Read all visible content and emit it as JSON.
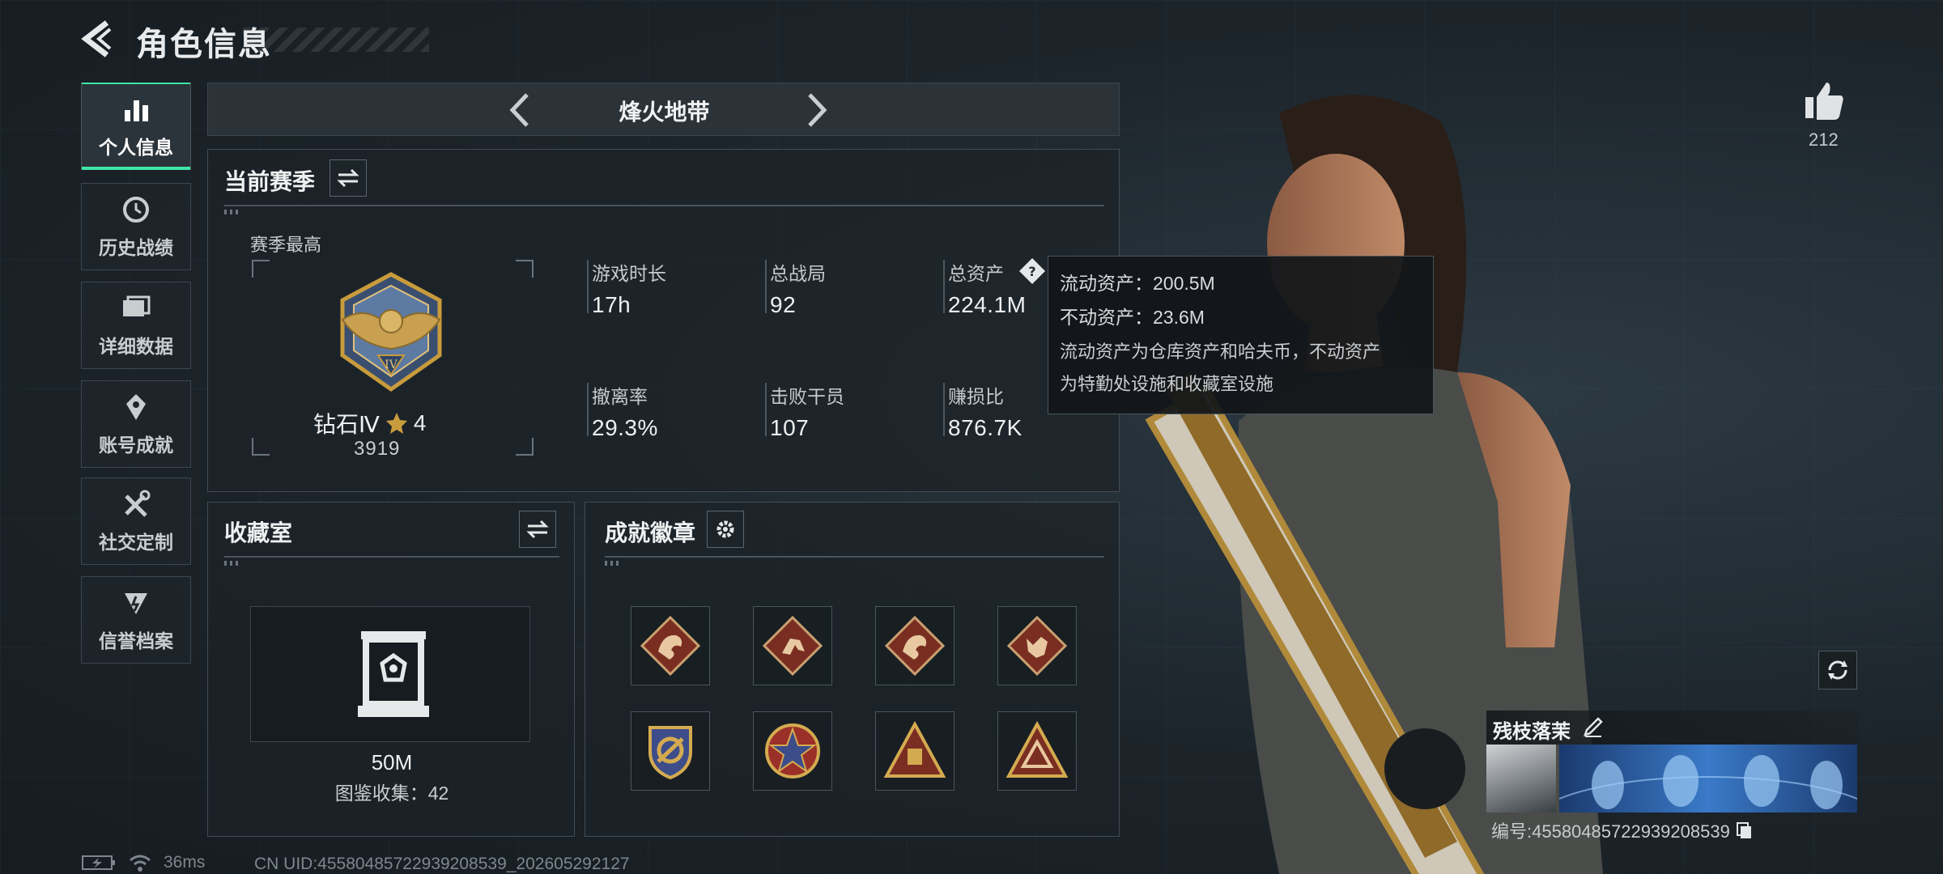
{
  "header": {
    "title": "角色信息"
  },
  "sidebar": {
    "items": [
      {
        "label": "个人信息",
        "icon": "bar-chart-icon",
        "active": true
      },
      {
        "label": "历史战绩",
        "icon": "history-icon"
      },
      {
        "label": "详细数据",
        "icon": "folder-icon"
      },
      {
        "label": "账号成就",
        "icon": "achievement-icon"
      },
      {
        "label": "社交定制",
        "icon": "tools-icon"
      },
      {
        "label": "信誉档案",
        "icon": "reputation-icon"
      }
    ]
  },
  "mode": {
    "title": "烽火地带"
  },
  "season": {
    "title": "当前赛季",
    "best_label": "赛季最高",
    "rank_name": "钻石Ⅳ",
    "rank_stars": "4",
    "rank_score": "3919",
    "stats": [
      {
        "label": "游戏时长",
        "value": "17h"
      },
      {
        "label": "总战局",
        "value": "92"
      },
      {
        "label": "总资产",
        "value": "224.1M"
      },
      {
        "label": "撤离率",
        "value": "29.3%"
      },
      {
        "label": "击败干员",
        "value": "107"
      },
      {
        "label": "赚损比",
        "value": "876.7K"
      }
    ]
  },
  "tooltip": {
    "liquid": "流动资产：200.5M",
    "fixed": "不动资产：23.6M",
    "desc_line1": "流动资产为仓库资产和哈夫币，不动资产",
    "desc_line2": "为特勤处设施和收藏室设施"
  },
  "collection": {
    "title": "收藏室",
    "value": "50M",
    "catalog": "图鉴收集：42"
  },
  "achievements": {
    "title": "成就徽章",
    "badges": [
      "dragon-badge-icon",
      "runner-badge-icon",
      "dragon-badge-icon",
      "wolf-badge-icon",
      "shield-badge-icon",
      "star-badge-icon",
      "pyramid-badge-icon",
      "eye-triangle-badge-icon"
    ]
  },
  "profile": {
    "likes": "212",
    "name": "残枝落茉",
    "id": "编号:45580485722939208539"
  },
  "status": {
    "ping": "36ms",
    "uid": "CN UID:45580485722939208539_202605292127"
  },
  "colors": {
    "accent": "#3fe6a8",
    "rank_gold": "#c89b3c",
    "badge_red": "#7a2e22"
  }
}
